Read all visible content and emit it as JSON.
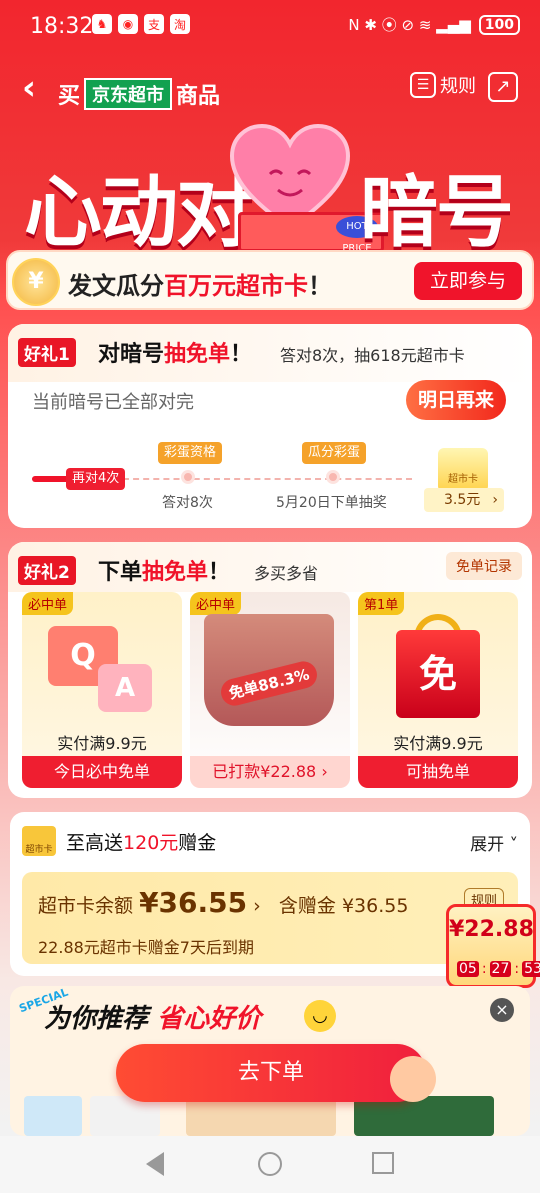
{
  "status": {
    "time": "18:32",
    "battery": "100",
    "app_icons": [
      "qq-icon",
      "dingtalk-icon",
      "alipay-icon",
      "taobao-icon"
    ],
    "app_glyphs": [
      "♞",
      "◉",
      "支",
      "淘"
    ],
    "sys_icons": "N ✱ ⦿ ⊘ ≋ ▂▄▆"
  },
  "header": {
    "back_icon": "‹",
    "buy_label": "买",
    "store_name": "京东超市",
    "goods_label": "商品",
    "rules_label": "规则",
    "rules_icon": "☰",
    "share_icon": "↗"
  },
  "banner": {
    "left_title": "心动对",
    "right_title": "暗号",
    "hot_price": "HOT PRICE"
  },
  "join": {
    "coin_symbol": "¥",
    "text_prefix": "发文瓜分",
    "text_highlight": "百万元超市卡",
    "text_suffix": "！",
    "button": "立即参与"
  },
  "gift1": {
    "tag": "好礼1",
    "title_prefix": "对暗号",
    "title_highlight": "抽免单",
    "title_suffix": "！",
    "subtitle": "答对8次，抽618元超市卡",
    "note": "当前暗号已全部对完",
    "button": "明日再来",
    "progress_pill": "再对4次",
    "steps": [
      {
        "pill": "彩蛋资格",
        "label": "答对8次"
      },
      {
        "pill": "瓜分彩蛋",
        "label": "5月20日下单抽奖"
      }
    ],
    "card_label": "超市卡",
    "card_price": "3.5元",
    "card_arrow": "›"
  },
  "gift2": {
    "tag": "好礼2",
    "title_prefix": "下单",
    "title_highlight": "抽免单",
    "title_suffix": "！",
    "subtitle": "多买多省",
    "record_button": "免单记录",
    "prizes": [
      {
        "tag": "必中单",
        "pay": "实付满9.9元",
        "button": "今日必中免单",
        "q": "Q",
        "a": "A"
      },
      {
        "tag": "必中单",
        "badge": "免单88.3%",
        "button": "已打款¥22.88 ›"
      },
      {
        "tag": "第1单",
        "bag_text": "免",
        "pay": "实付满9.9元",
        "button": "可抽免单"
      }
    ]
  },
  "supermarket": {
    "icon_label": "超市卡",
    "title_prefix": "至高送",
    "title_amount": "120元",
    "title_suffix": "赠金",
    "expand": "展开 ˅",
    "balance_label": "超市卡余额",
    "balance_value": "¥36.55",
    "balance_arrow": "›",
    "bonus_label": "含赠金",
    "bonus_value": "¥36.55",
    "rule": "规则",
    "expire": "22.88元超市卡赠金7天后到期"
  },
  "float_widget": {
    "amount": "¥22.88",
    "hh": "05",
    "mm": "27",
    "ss": "53",
    "sep": ":"
  },
  "recommend": {
    "special": "SPECIAL",
    "title_prefix": "为你推荐",
    "title_highlight": "省心好价",
    "smile": "◡",
    "close_icon": "×",
    "order_button": "去下单"
  },
  "colors": {
    "brand_red": "#f0132a",
    "jd_green": "#12a150",
    "gold": "#ffd24a"
  }
}
